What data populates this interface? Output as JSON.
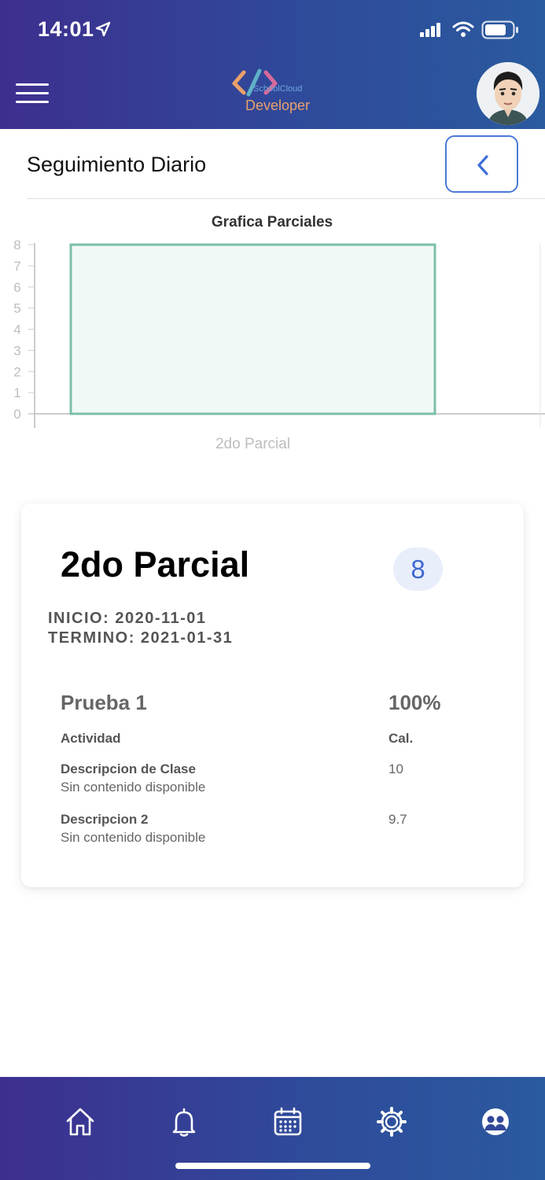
{
  "status_bar": {
    "time": "14:01"
  },
  "header": {
    "logo_small": "SchoolCloud",
    "logo_big": "Developer"
  },
  "page": {
    "title": "Seguimiento Diario"
  },
  "chart_data": {
    "type": "bar",
    "title": "Grafica Parciales",
    "categories": [
      "2do Parcial"
    ],
    "values": [
      8
    ],
    "ylim": [
      0,
      8
    ],
    "yticks": [
      "0",
      "1",
      "2",
      "3",
      "4",
      "5",
      "6",
      "7",
      "8"
    ],
    "xlabel": "",
    "ylabel": "",
    "grid": false,
    "colors": {
      "bar_fill": "#f1f9f7",
      "bar_stroke": "#7bbfaa"
    }
  },
  "card": {
    "title": "2do Parcial",
    "grade": "8",
    "start": "INICIO: 2020-11-01",
    "end": "TERMINO: 2021-01-31",
    "section_name": "Prueba 1",
    "section_pct": "100%",
    "col_activity": "Actividad",
    "col_grade": "Cal.",
    "activities": [
      {
        "name": "Descripcion de Clase",
        "desc": "Sin contenido disponible",
        "score": "10"
      },
      {
        "name": "Descripcion 2",
        "desc": "Sin contenido disponible",
        "score": "9.7"
      }
    ]
  },
  "tabbar": {
    "icons": [
      "home-icon",
      "bell-icon",
      "calendar-icon",
      "settings-icon",
      "users-icon"
    ]
  },
  "colors": {
    "header_start": "#3d2f8f",
    "header_end": "#2a5a9f",
    "accent": "#4a7ad8",
    "grade_badge_bg": "#e9eefb"
  }
}
